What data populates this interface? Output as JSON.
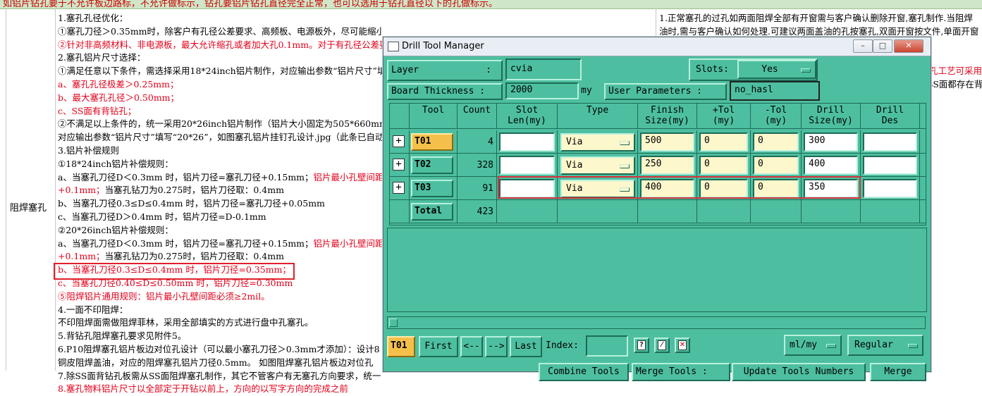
{
  "spreadsheet": {
    "top_text": "如铝片钻孔要于不允许板边路标，不允许做标示，钻孔要铝片钻孔直径完全正常，也可以选用于钻孔直径以下的孔做标示。",
    "row_label": "阻焊塞孔",
    "lines": [
      {
        "t": "1.塞孔孔径优化：",
        "c": "k"
      },
      {
        "t": "①塞孔刀径＞0.35mm时，除客户有孔径公差要求、高频板、电源板外，尽可能缩小刀径优化到0.35mm刀径以下。",
        "c": "k"
      },
      {
        "t": "②针对非高频材料、非电源板，最大允许缩孔或者加大孔0.1mm。对于有孔径公差要求",
        "c": "r"
      },
      {
        "t": "2.塞孔铝片尺寸选择：",
        "c": "k"
      },
      {
        "t": "①满足任意以下条件，需选择采用18*24inch铝片制作，对应输出参数“铝片尺寸”填",
        "c": "k"
      },
      {
        "t": "a、塞孔孔径极差＞0.25mm；",
        "c": "r"
      },
      {
        "t": "b、最大塞孔孔径＞0.50mm；",
        "c": "r"
      },
      {
        "t": "c、SS面有背钻孔；",
        "c": "r"
      },
      {
        "t": "②不满足以上条件的，统一采用20*26inch铝片制作（铝片大小固定为505*660mm）",
        "c": "k"
      },
      {
        "t": "对应输出参数“铝片尺寸”填写“20*26”，如图塞孔铝片挂钉孔设计.jpg（此条已自动",
        "c": "k"
      },
      {
        "t": "3.铝片补偿规则",
        "c": "k"
      },
      {
        "t": "①18*24inch铝片补偿规则：",
        "c": "k"
      },
      {
        "t": "a、当塞孔刀径D＜0.3mm 时，铝片刀径=塞孔刀径+0.15mm；铝片最小孔壁间距必须",
        "c": "m"
      },
      {
        "t": "+0.1mm；当塞孔钻刀为0.275时，铝片刀径取：0.4mm",
        "c": "m2"
      },
      {
        "t": "b、当塞孔刀径0.3≤D≤0.4mm 时，铝片刀径=塞孔刀径+0.05mm",
        "c": "k"
      },
      {
        "t": "c、当塞孔刀径D＞0.4mm 时，铝片刀径=D-0.1mm",
        "c": "k"
      },
      {
        "t": "②20*26inch铝片补偿规则：",
        "c": "k"
      },
      {
        "t": "a、当塞孔刀径D＜0.3mm 时，铝片刀径=塞孔刀径+0.15mm；铝片最小孔壁间距必须",
        "c": "m"
      },
      {
        "t": "+0.1mm；当塞孔钻刀为0.275时，铝片刀径取：0.4mm",
        "c": "m2"
      },
      {
        "t": "b、当塞孔刀径0.3≤D≤0.4mm 时，铝片刀径=0.35mm；",
        "c": "r"
      },
      {
        "t": "c、当塞孔刀径0.40≤D≤0.50mm 时，铝片刀径=0.30mm",
        "c": "r"
      },
      {
        "t": "⑤阻焊铝片通用规则：铝片最小孔壁间距必须≥2mil。",
        "c": "r"
      },
      {
        "t": "4.一面不印阻焊：",
        "c": "k"
      },
      {
        "t": "不印阻焊面需做阻焊菲林，采用全部填实的方式进行盘中孔塞孔。",
        "c": "k"
      },
      {
        "t": "5.背钻孔阻焊塞孔要求见附件5。",
        "c": "k"
      },
      {
        "t": "6.P10阻焊塞孔铝片板边对位孔设计（可以最小塞孔刀径＞0.3mm才添加）：设计8",
        "c": "k"
      },
      {
        "t": "铜皮阻焊盖油，对应的阻焊塞孔铝片刀径0.5mm。 如图阻焊塞孔铝片板边对位孔",
        "c": "k"
      },
      {
        "t": "7.除SS面背钻孔板需从SS面阻焊塞孔制作，其它不管客户有无塞孔方向要求，统一",
        "c": "k"
      },
      {
        "t": "8.塞孔物料铝片尺寸以全部定于开钻以前上，方向的以写字方向的完成之前",
        "c": "r"
      }
    ],
    "right_lines": [
      {
        "t": "1.正常塞孔的过孔如两面阻焊全部有开窗需与客户确认删除开窗,塞孔制作.当阻焊",
        "c": "k"
      },
      {
        "t": "油时,需与客户确认如何处理.可建议两面盖油的孔按塞孔,双面开窗按文件,单面开窗",
        "c": "k"
      },
      {
        "t": "",
        "c": "k"
      },
      {
        "t": "",
        "c": "k"
      },
      {
        "t": "孔工艺可采用",
        "c": "r"
      },
      {
        "t": "SS面都存在背",
        "c": "k"
      }
    ]
  },
  "dialog": {
    "title": "Drill Tool Manager",
    "layer_label": "Layer",
    "layer_colon": ":",
    "layer_value": "cvia",
    "slots_label": "Slots:",
    "slots_value": "Yes",
    "thickness_label": "Board Thickness :",
    "thickness_value": "2000",
    "thickness_unit": "my",
    "user_params_label": "User Parameters :",
    "user_params_value": "no_hasl",
    "columns": [
      "Tool",
      "Count",
      "Slot\nLen(my)",
      "Type",
      "Finish\nSize(my)",
      "+Tol\n(my)",
      "-Tol\n(my)",
      "Drill\nSize(my)",
      "Drill\nDes"
    ],
    "rows": [
      {
        "tool": "T01",
        "count": "4",
        "slot": "",
        "type": "Via",
        "finish": "500",
        "ptol": "0",
        "ntol": "0",
        "drill": "300",
        "des": ""
      },
      {
        "tool": "T02",
        "count": "328",
        "slot": "",
        "type": "Via",
        "finish": "250",
        "ptol": "0",
        "ntol": "0",
        "drill": "400",
        "des": ""
      },
      {
        "tool": "T03",
        "count": "91",
        "slot": "",
        "type": "Via",
        "finish": "400",
        "ptol": "0",
        "ntol": "0",
        "drill": "350",
        "des": ""
      }
    ],
    "total_label": "Total",
    "total_count": "423",
    "current_tool": "T01",
    "first_label": "First",
    "prev_label": "<--",
    "next_label": "-->",
    "last_label": "Last",
    "index_label": "Index:",
    "units_value": "ml/my",
    "mode_value": "Regular",
    "bottom_buttons": [
      "Combine Tools",
      "Merge Tools :",
      "Update Tools Numbers",
      "Merge"
    ]
  }
}
